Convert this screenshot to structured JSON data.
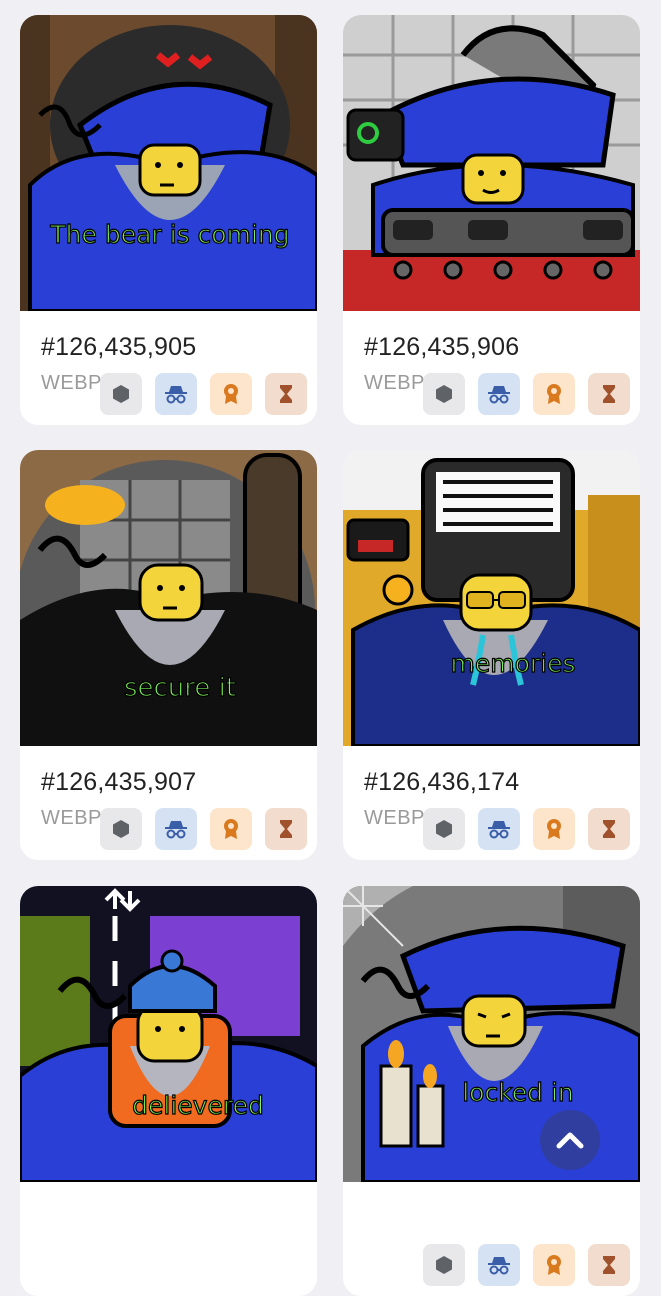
{
  "cards": [
    {
      "number": "#126,435,905",
      "format": "WEBP",
      "caption": "The bear is coming"
    },
    {
      "number": "#126,435,906",
      "format": "WEBP",
      "caption": ""
    },
    {
      "number": "#126,435,907",
      "format": "WEBP",
      "caption": "secure it"
    },
    {
      "number": "#126,436,174",
      "format": "WEBP",
      "caption": "memories"
    },
    {
      "number": "",
      "format": "",
      "caption": "delievered"
    },
    {
      "number": "",
      "format": "",
      "caption": "locked in"
    }
  ],
  "badge_icons": [
    "hexagon-icon",
    "incognito-icon",
    "medal-icon",
    "hourglass-icon"
  ],
  "colors": {
    "page_bg": "#efeff4",
    "wizard_blue": "#2a3fd6",
    "caption_green": "#7df25a",
    "badge_gray": "#e8e8ea",
    "badge_blue": "#d5e2f4",
    "badge_orange": "#fde5cc",
    "badge_brown": "#f1dccd"
  }
}
